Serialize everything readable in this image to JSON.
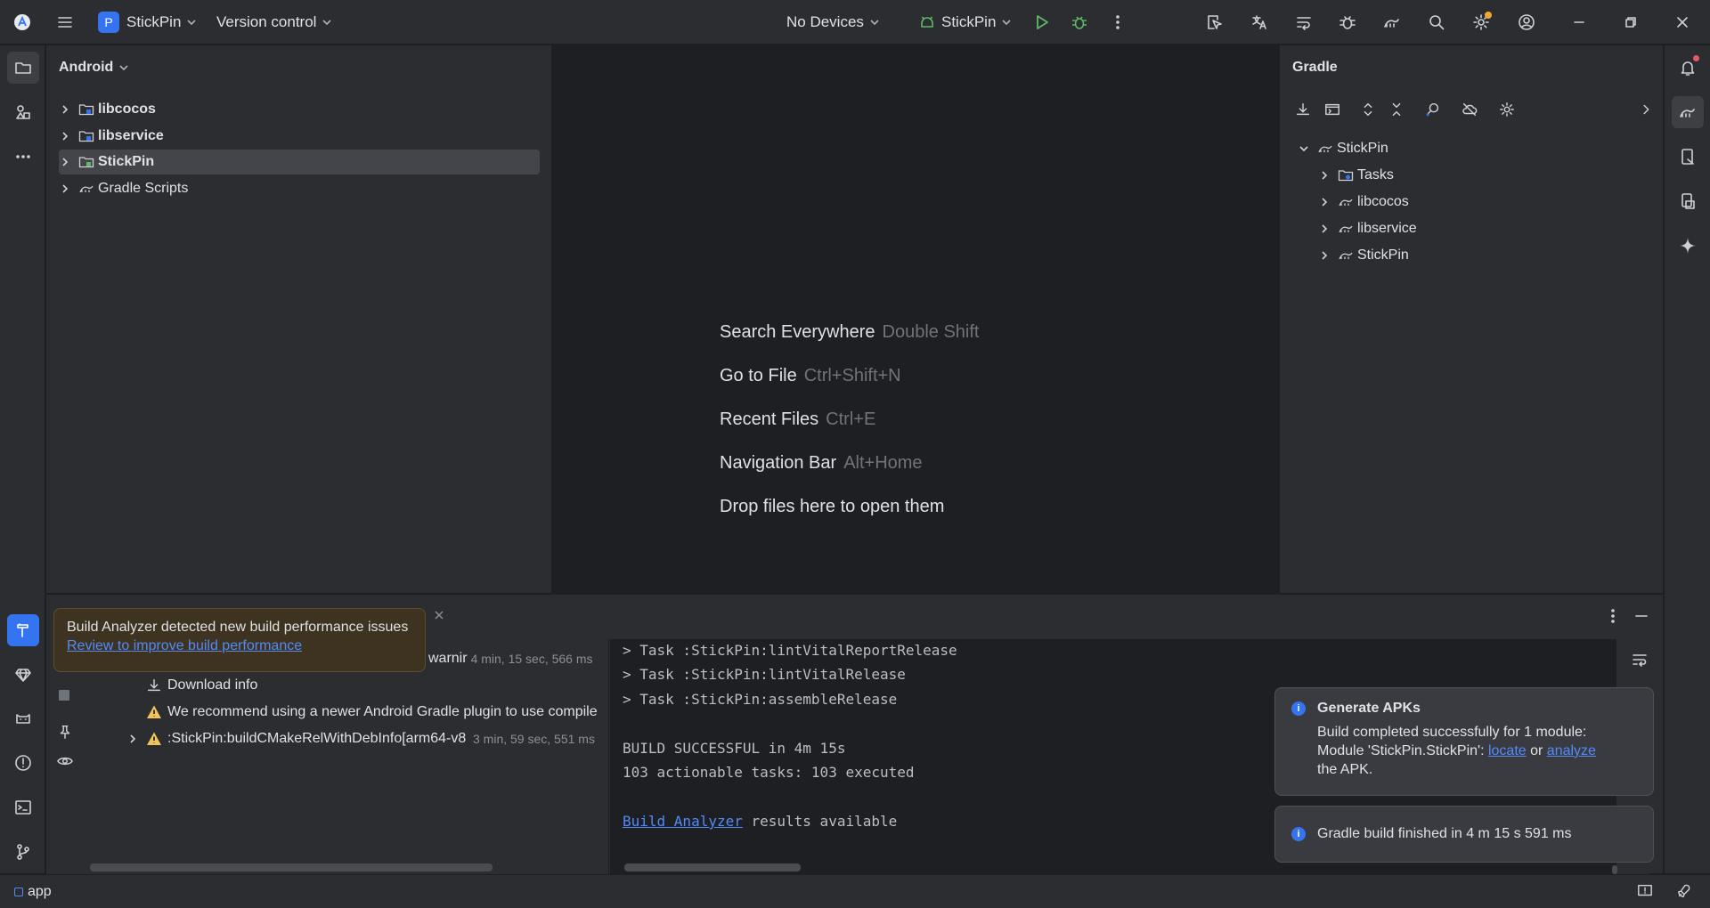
{
  "titlebar": {
    "project_initial": "P",
    "project_name": "StickPin",
    "version_control": "Version control",
    "device": "No Devices",
    "run_config": "StickPin"
  },
  "project_panel": {
    "title": "Android",
    "items": [
      {
        "label": "libcocos"
      },
      {
        "label": "libservice"
      },
      {
        "label": "StickPin"
      },
      {
        "label": "Gradle Scripts"
      }
    ]
  },
  "editor": {
    "hints": [
      {
        "action": "Search Everywhere",
        "key": "Double Shift"
      },
      {
        "action": "Go to File",
        "key": "Ctrl+Shift+N"
      },
      {
        "action": "Recent Files",
        "key": "Ctrl+E"
      },
      {
        "action": "Navigation Bar",
        "key": "Alt+Home"
      },
      {
        "action": "Drop files here to open them",
        "key": ""
      }
    ]
  },
  "gradle_panel": {
    "title": "Gradle",
    "root": "StickPin",
    "children": [
      {
        "label": "Tasks"
      },
      {
        "label": "libcocos"
      },
      {
        "label": "libservice"
      },
      {
        "label": "StickPin"
      }
    ]
  },
  "build_panel": {
    "rows": [
      {
        "label": "warnir",
        "meta": "4 min, 15 sec, 566 ms"
      },
      {
        "label": "Download info",
        "meta": ""
      },
      {
        "label": "We recommend using a newer Android Gradle plugin to use compile",
        "meta": ""
      },
      {
        "label": ":StickPin:buildCMakeRelWithDebInfo[arm64-v8",
        "meta": "3 min, 59 sec, 551 ms"
      }
    ],
    "console": [
      "> Task :StickPin:lintVitalReportRelease",
      "> Task :StickPin:lintVitalRelease",
      "> Task :StickPin:assembleRelease",
      "BUILD SUCCESSFUL in 4m 15s",
      "103 actionable tasks: 103 executed"
    ],
    "analyzer_link": "Build Analyzer",
    "analyzer_suffix": " results available"
  },
  "build_tip": {
    "message": "Build Analyzer detected new build performance issues",
    "link": "Review to improve build performance"
  },
  "notifications": {
    "apk": {
      "title": "Generate APKs",
      "line1": "Build completed successfully for 1 module:",
      "line2_prefix": "Module 'StickPin.StickPin': ",
      "locate": "locate",
      "or": " or ",
      "analyze": "analyze",
      "line3": "the APK."
    },
    "gradle": {
      "message": "Gradle build finished in 4 m 15 s 591 ms"
    }
  },
  "statusbar": {
    "module": "app"
  },
  "colors": {
    "accent": "#3574f0",
    "run_green": "#5fb865",
    "warning": "#f2c55c",
    "badge": "#f0a732"
  }
}
